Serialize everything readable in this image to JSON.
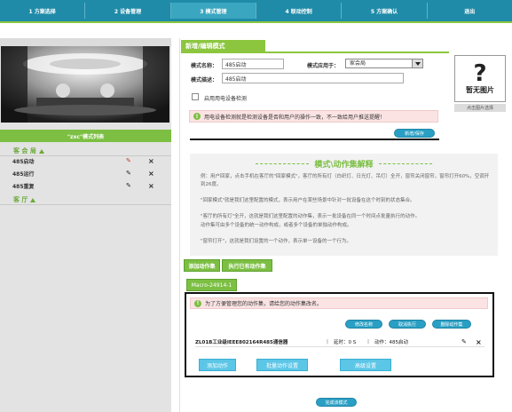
{
  "nav": {
    "tabs": [
      "1 方案选择",
      "2 设备管理",
      "3 模式管理",
      "4 联动控制",
      "5 方案确认",
      "退出"
    ],
    "active_index": 2
  },
  "left": {
    "list_title": "\"zxc\"模式列表",
    "groups": [
      {
        "name": "客 会 局",
        "modes": [
          "485启动",
          "485运行",
          "485重复"
        ]
      },
      {
        "name": "客 厅",
        "modes": []
      }
    ]
  },
  "form": {
    "panel_title": "新增/编辑模式",
    "mode_name_label": "模式名称：",
    "mode_name_value": "485启动",
    "apply_to_label": "模式应用于：",
    "apply_to_value": "家会局",
    "mode_desc_label": "模式描述：",
    "mode_desc_value": "485启动",
    "checkbox_label": "启用用电设备检测",
    "notice": "用电设备检测就是检测设备是否和用户的操作一致，不一致给用户推送提醒！",
    "save_button": "新增/保存",
    "image_placeholder": "暂无图片",
    "image_select_button": "点击图片选择"
  },
  "explain": {
    "title": "模式\\动作集解释",
    "paragraphs": [
      "例：用户回家，点击手机在客厅的\"回家模式\"，客厅的所有灯（白织灯、日光灯、吊灯）全开，窗帘关闭窗帘，窗帘打开60%，空调开到26度。",
      "\"回家模式\"就是我们这里配置的模式，表示用户在某些场景中针对一批设备在这个时刻的状态集合。",
      "\"客厅的所有灯\"全开，这就是我们这里配置的动作集，表示一批设备在同一个时间点批量执行的动作。",
      "动作集可由多个设备的统一动作构成，或者多个设备的单独动作构成。",
      "\"窗帘打开\"，这就是我们设置的一个动作，表示单一设备的一个行为。"
    ]
  },
  "actions": {
    "add_action_set": "添加动作集",
    "run_existing_set": "执行已有动作集",
    "macro_tab": "Macro-24914-1",
    "macro_notice": "为了方便管理您的动作集，请给您的动作集改名。",
    "rename_button": "修改名称",
    "cancel_run_button": "取消执行",
    "delete_set_button": "删除动作集",
    "device_row": {
      "device": "ZL01B工业级IEEE802164R485通信器",
      "delay": "延时：0 S",
      "action": "动作：485启动"
    },
    "add_action": "添加动作",
    "batch_action_setting": "批量动作设置",
    "advanced_setting": "高级设置",
    "finish_mode": "完成该模式"
  }
}
